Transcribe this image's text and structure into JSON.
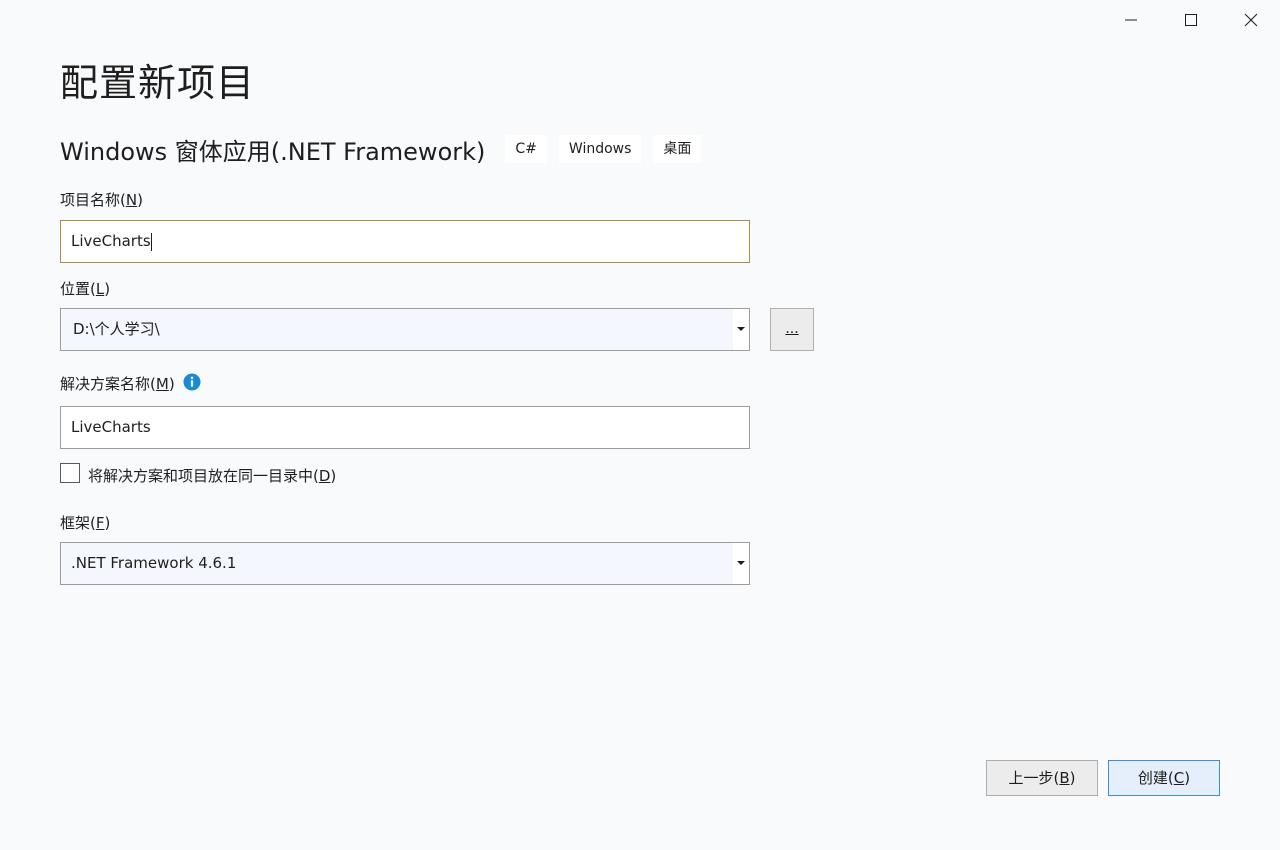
{
  "window": {
    "controls": {
      "minimize": "minimize-icon",
      "maximize": "maximize-icon",
      "close": "close-icon"
    }
  },
  "page": {
    "title": "配置新项目",
    "template_name": "Windows 窗体应用(.NET Framework)",
    "tags": [
      "C#",
      "Windows",
      "桌面"
    ]
  },
  "project_name": {
    "label": "项目名称(",
    "accesskey": "N",
    "label_end": ")",
    "value": "LiveCharts"
  },
  "location": {
    "label": "位置(",
    "accesskey": "L",
    "label_end": ")",
    "value": "D:\\个人学习\\",
    "browse_label": "..."
  },
  "solution_name": {
    "label": "解决方案名称(",
    "accesskey": "M",
    "label_end": ")",
    "value": "LiveCharts",
    "info_icon": "info-icon"
  },
  "same_dir": {
    "label": "将解决方案和项目放在同一目录中(",
    "accesskey": "D",
    "label_end": ")",
    "checked": false
  },
  "framework": {
    "label": "框架(",
    "accesskey": "F",
    "label_end": ")",
    "value": ".NET Framework 4.6.1"
  },
  "buttons": {
    "back": {
      "label": "上一步(",
      "accesskey": "B",
      "label_end": ")"
    },
    "create": {
      "label": "创建(",
      "accesskey": "C",
      "label_end": ")"
    }
  },
  "colors": {
    "background": "#f9fafc",
    "focus_border": "#a78f4a",
    "primary_border": "#3e8fd6",
    "info_blue": "#1b8ad6"
  }
}
